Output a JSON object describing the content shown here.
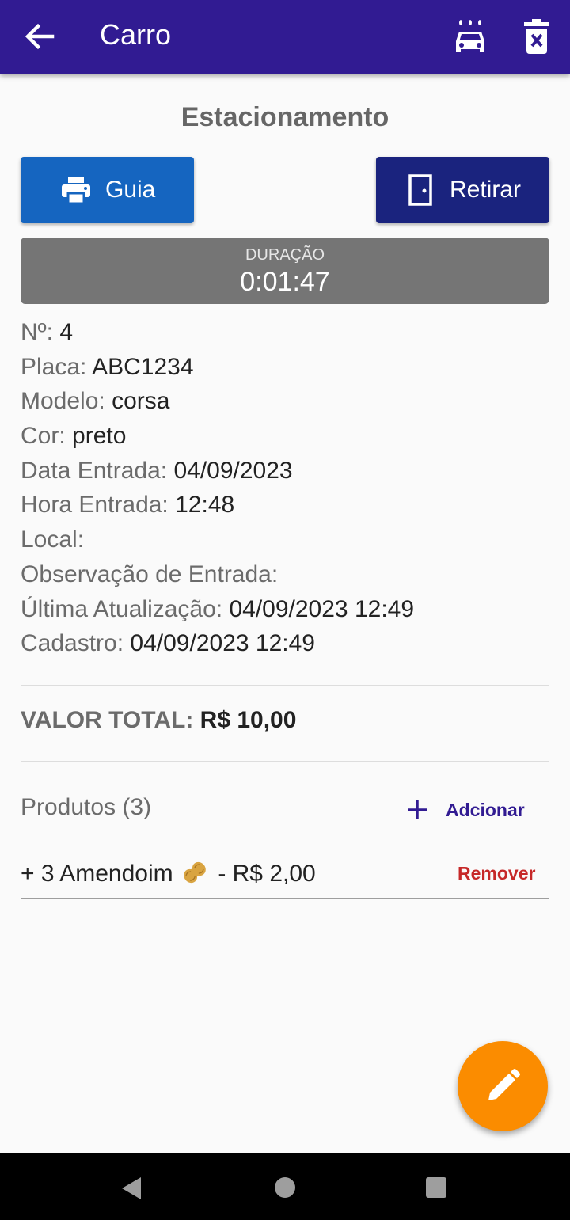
{
  "appbar": {
    "title": "Carro",
    "back_icon": "arrow-left-icon",
    "wash_icon": "car-wash-icon",
    "delete_icon": "trash-x-icon",
    "color": "#311b92"
  },
  "section_title": "Estacionamento",
  "buttons": {
    "guia_label": "Guia",
    "guia_icon": "printer-icon",
    "guia_color": "#1565c0",
    "retirar_label": "Retirar",
    "retirar_icon": "door-icon",
    "retirar_color": "#1a237e"
  },
  "duration": {
    "label": "DURAÇÃO",
    "value": "0:01:47"
  },
  "details": [
    {
      "label": "Nº:",
      "value": "4"
    },
    {
      "label": "Placa:",
      "value": "ABC1234"
    },
    {
      "label": "Modelo:",
      "value": "corsa"
    },
    {
      "label": "Cor:",
      "value": "preto"
    },
    {
      "label": "Data Entrada:",
      "value": "04/09/2023"
    },
    {
      "label": "Hora Entrada:",
      "value": "12:48"
    },
    {
      "label": "Local:",
      "value": ""
    },
    {
      "label": "Observação de Entrada:",
      "value": ""
    },
    {
      "label": "Última Atualização:",
      "value": "04/09/2023 12:49"
    },
    {
      "label": "Cadastro:",
      "value": "04/09/2023 12:49"
    }
  ],
  "total": {
    "label": "VALOR TOTAL:",
    "value": "R$ 10,00"
  },
  "products": {
    "label": "Produtos (3)",
    "add_label": "Adcionar",
    "add_icon": "plus-icon",
    "items": [
      {
        "text_before": "+ 3 Amendoim",
        "emoji_icon": "peanut-icon",
        "text_after": "- R$ 2,00",
        "remove_label": "Remover"
      }
    ]
  },
  "fab": {
    "icon": "pencil-icon",
    "color": "#fb8c00"
  },
  "navbar": {
    "back_icon": "nav-back-icon",
    "home_icon": "nav-home-icon",
    "recent_icon": "nav-recent-icon"
  }
}
